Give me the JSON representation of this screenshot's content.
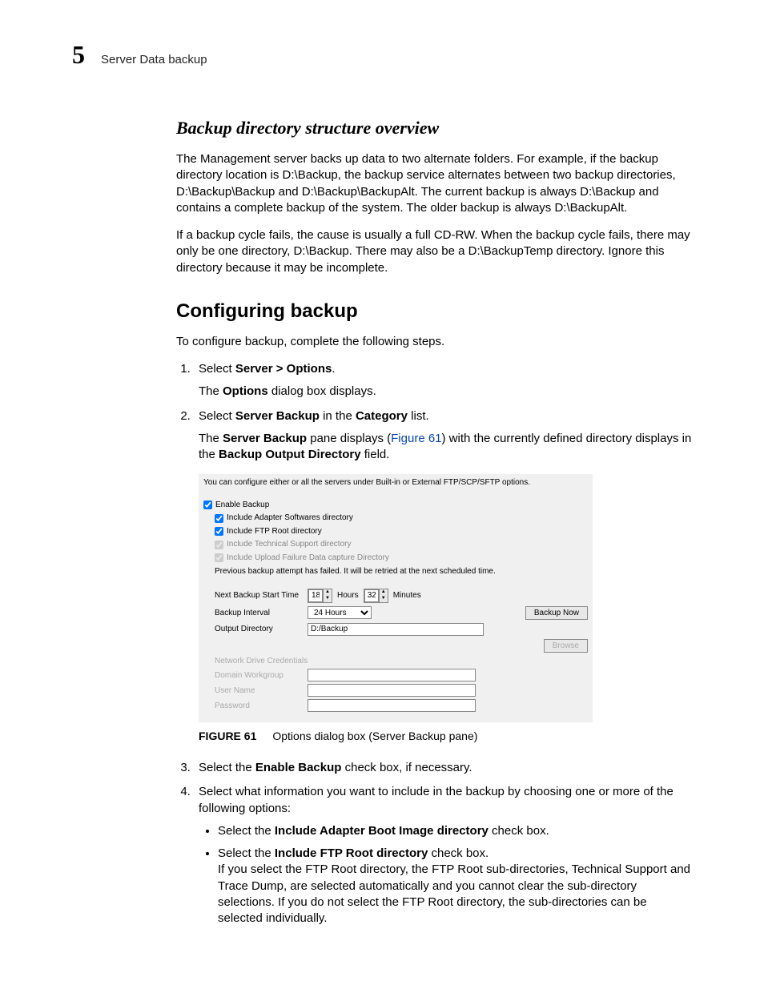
{
  "header": {
    "chapter_number": "5",
    "running_header": "Server Data backup"
  },
  "section1": {
    "heading": "Backup directory structure overview",
    "p1": "The Management server backs up data to two alternate folders. For example, if the backup directory location is D:\\Backup, the backup service alternates between two backup directories, D:\\Backup\\Backup and D:\\Backup\\BackupAlt. The current backup is always D:\\Backup and contains a complete backup of the system. The older backup is always D:\\BackupAlt.",
    "p2": "If a backup cycle fails, the cause is usually a full CD-RW. When the backup cycle fails, there may only be one directory, D:\\Backup. There may also be a D:\\BackupTemp directory. Ignore this directory because it may be incomplete."
  },
  "section2": {
    "heading": "Configuring backup",
    "intro": "To configure backup, complete the following steps.",
    "step1": {
      "pre": "Select ",
      "bold": "Server > Options",
      "post": ".",
      "sub_pre": "The ",
      "sub_bold": "Options",
      "sub_post": " dialog box displays."
    },
    "step2": {
      "pre": "Select ",
      "bold1": "Server Backup",
      "mid": " in the ",
      "bold2": "Category",
      "post": " list.",
      "sub_pre": "The ",
      "sub_bold1": "Server Backup",
      "sub_mid1": " pane displays (",
      "link": "Figure 61",
      "sub_mid2": ") with the currently defined directory displays in the ",
      "sub_bold2": "Backup Output Directory",
      "sub_post": " field."
    },
    "step3": {
      "pre": "Select the ",
      "bold": "Enable Backup",
      "post": " check box, if necessary."
    },
    "step4": {
      "text": "Select what information you want to include in the backup by choosing one or more of the following options:",
      "b1_pre": "Select the ",
      "b1_bold": "Include Adapter Boot Image directory",
      "b1_post": " check box.",
      "b2_pre": "Select the ",
      "b2_bold": "Include FTP Root directory",
      "b2_post": " check box.",
      "b2_sub": "If you select the FTP Root directory, the FTP Root sub-directories, Technical Support and Trace Dump, are selected automatically and you cannot clear the sub-directory selections. If you do not select the FTP Root directory, the sub-directories can be selected individually."
    }
  },
  "figure": {
    "number": "FIGURE 61",
    "caption": "Options dialog box (Server Backup pane)",
    "intro_text": "You can configure either or all the servers under Built-in or External FTP/SCP/SFTP options.",
    "enable_backup": "Enable Backup",
    "cb_adapter": "Include Adapter Softwares directory",
    "cb_ftp": "Include FTP Root directory",
    "cb_tech": "Include Technical Support directory",
    "cb_upload": "Include Upload Failure Data capture Directory",
    "status_msg": "Previous backup attempt has failed.  It will be retried at the next scheduled time.",
    "next_backup_label": "Next Backup Start Time",
    "hours_value": "18",
    "hours_label": "Hours",
    "minutes_value": "32",
    "minutes_label": "Minutes",
    "interval_label": "Backup Interval",
    "interval_value": "24 Hours",
    "backup_now": "Backup Now",
    "output_dir_label": "Output Directory",
    "output_dir_value": "D:/Backup",
    "browse": "Browse",
    "cred_header": "Network Drive Credentials",
    "domain_label": "Domain Workgroup",
    "user_label": "User Name",
    "pass_label": "Password"
  }
}
